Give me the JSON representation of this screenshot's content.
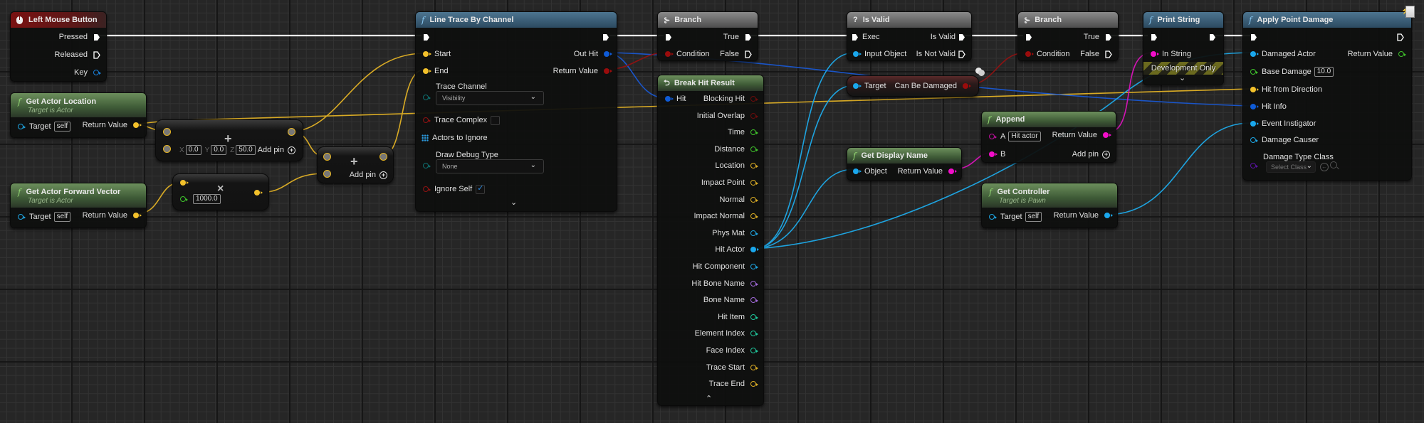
{
  "colors": {
    "exec": "#ffffff",
    "vector": "#f3c12b",
    "object": "#1aa7ec",
    "struct": "#0f5bd6",
    "bool": "#9a0c0c",
    "float": "#3ec02b",
    "string": "#f20ec9",
    "name": "#a068d8",
    "int": "#1fc49a",
    "enum": "#0e6f6f",
    "class": "#5a12a0"
  },
  "nodes": {
    "left_mouse": {
      "title": "Left Mouse Button",
      "icon": "mouse-icon",
      "pins": {
        "pressed": "Pressed",
        "released": "Released",
        "key": "Key"
      }
    },
    "get_actor_location": {
      "title": "Get Actor Location",
      "subtitle": "Target is Actor",
      "target_label": "Target",
      "target_value": "self",
      "return_label": "Return Value"
    },
    "get_actor_forward": {
      "title": "Get Actor Forward Vector",
      "subtitle": "Target is Actor",
      "target_label": "Target",
      "target_value": "self",
      "return_label": "Return Value"
    },
    "add_vector_1": {
      "operator": "+",
      "x_label": "X",
      "x": "0.0",
      "y_label": "Y",
      "y": "0.0",
      "z_label": "Z",
      "z": "50.0",
      "add_pin": "Add pin"
    },
    "add_vector_2": {
      "operator": "+",
      "add_pin": "Add pin"
    },
    "multiply": {
      "operator": "×",
      "value": "1000.0"
    },
    "line_trace": {
      "title": "Line Trace By Channel",
      "start": "Start",
      "end": "End",
      "trace_channel": "Trace Channel",
      "trace_channel_value": "Visibility",
      "trace_complex": "Trace Complex",
      "trace_complex_checked": false,
      "actors_to_ignore": "Actors to Ignore",
      "draw_debug": "Draw Debug Type",
      "draw_debug_value": "None",
      "ignore_self": "Ignore Self",
      "ignore_self_checked": true,
      "out_hit": "Out Hit",
      "return_value": "Return Value"
    },
    "branch_1": {
      "title": "Branch",
      "condition": "Condition",
      "true_label": "True",
      "false_label": "False"
    },
    "break_hit": {
      "title": "Break Hit Result",
      "hit": "Hit",
      "outputs": [
        "Blocking Hit",
        "Initial Overlap",
        "Time",
        "Distance",
        "Location",
        "Impact Point",
        "Normal",
        "Impact Normal",
        "Phys Mat",
        "Hit Actor",
        "Hit Component",
        "Hit Bone Name",
        "Bone Name",
        "Hit Item",
        "Element Index",
        "Face Index",
        "Trace Start",
        "Trace End"
      ]
    },
    "is_valid": {
      "title": "Is Valid",
      "exec": "Exec",
      "input_object": "Input Object",
      "is_valid": "Is Valid",
      "is_not_valid": "Is Not Valid"
    },
    "can_be_damaged": {
      "target": "Target",
      "output": "Can Be Damaged"
    },
    "get_display_name": {
      "title": "Get Display Name",
      "object": "Object",
      "return_label": "Return Value"
    },
    "branch_2": {
      "title": "Branch",
      "condition": "Condition",
      "true_label": "True",
      "false_label": "False"
    },
    "append": {
      "title": "Append",
      "a_label": "A",
      "a_value": "Hit actor",
      "b_label": "B",
      "return_label": "Return Value",
      "add_pin": "Add pin"
    },
    "get_controller": {
      "title": "Get Controller",
      "subtitle": "Target is Pawn",
      "target_label": "Target",
      "target_value": "self",
      "return_label": "Return Value"
    },
    "print_string": {
      "title": "Print String",
      "in_string": "In String",
      "dev_only": "Development Only"
    },
    "apply_point_damage": {
      "title": "Apply Point Damage",
      "damaged_actor": "Damaged Actor",
      "base_damage": "Base Damage",
      "base_damage_value": "10.0",
      "hit_from_direction": "Hit from Direction",
      "hit_info": "Hit Info",
      "event_instigator": "Event Instigator",
      "damage_causer": "Damage Causer",
      "damage_type_class": "Damage Type Class",
      "damage_type_value": "Select Class",
      "return_value": "Return Value"
    }
  }
}
